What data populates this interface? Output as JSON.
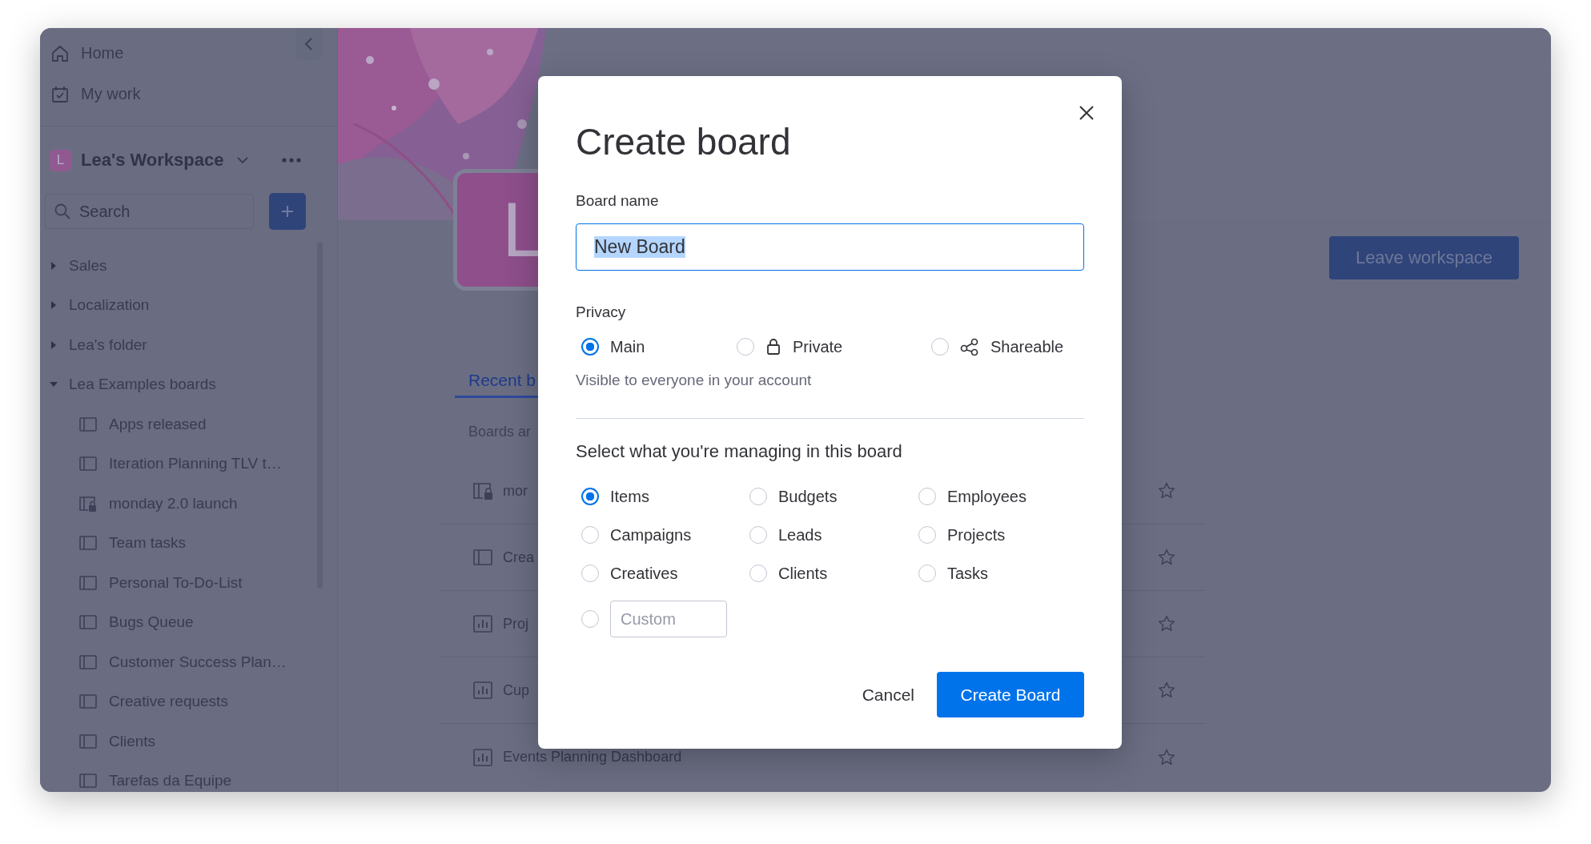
{
  "sidebar": {
    "nav": [
      {
        "label": "Home",
        "kind": "home"
      },
      {
        "label": "My work",
        "kind": "calendar"
      }
    ],
    "workspace": {
      "initial": "L",
      "name": "Lea's Workspace"
    },
    "search": {
      "placeholder": "Search"
    },
    "tree": [
      {
        "label": "Sales",
        "expanded": false
      },
      {
        "label": "Localization",
        "expanded": false
      },
      {
        "label": "Lea's folder",
        "expanded": false
      },
      {
        "label": "Lea Examples boards",
        "expanded": true,
        "children": [
          {
            "label": "Apps released",
            "kind": "board"
          },
          {
            "label": "Iteration Planning TLV t…",
            "kind": "board"
          },
          {
            "label": "monday 2.0 launch",
            "kind": "private-board"
          },
          {
            "label": "Team tasks",
            "kind": "board"
          },
          {
            "label": "Personal To-Do-List",
            "kind": "board"
          },
          {
            "label": "Bugs Queue",
            "kind": "board"
          },
          {
            "label": "Customer Success Plan…",
            "kind": "board"
          },
          {
            "label": "Creative requests",
            "kind": "board"
          },
          {
            "label": "Clients",
            "kind": "board"
          },
          {
            "label": "Tarefas da Equipe",
            "kind": "board"
          }
        ]
      }
    ]
  },
  "workspace_page": {
    "avatar": "L",
    "leave_button": "Leave workspace",
    "tabs": [
      {
        "label": "Recent b",
        "selected": true
      }
    ],
    "subtitle": "Boards ar",
    "boards": [
      {
        "name": "mor",
        "kind": "private-board"
      },
      {
        "name": "Crea",
        "kind": "board"
      },
      {
        "name": "Proj",
        "kind": "dashboard"
      },
      {
        "name": "Cup",
        "kind": "dashboard"
      },
      {
        "name": "Events Planning Dashboard",
        "kind": "dashboard"
      }
    ]
  },
  "dialog": {
    "title": "Create board",
    "board_name": {
      "label": "Board name",
      "value": "New Board"
    },
    "privacy": {
      "label": "Privacy",
      "options": [
        {
          "label": "Main",
          "selected": true
        },
        {
          "label": "Private",
          "kind": "private",
          "selected": false
        },
        {
          "label": "Shareable",
          "kind": "shareable",
          "selected": false
        }
      ],
      "hint": "Visible to everyone in your account"
    },
    "managing": {
      "title": "Select what you're managing in this board",
      "options": [
        {
          "kind": "option",
          "label": "Items",
          "selected": true
        },
        {
          "kind": "option",
          "label": "Budgets",
          "selected": false
        },
        {
          "kind": "option",
          "label": "Employees",
          "selected": false
        },
        {
          "kind": "option",
          "label": "Campaigns",
          "selected": false
        },
        {
          "kind": "option",
          "label": "Leads",
          "selected": false
        },
        {
          "kind": "option",
          "label": "Projects",
          "selected": false
        },
        {
          "kind": "option",
          "label": "Creatives",
          "selected": false
        },
        {
          "kind": "option",
          "label": "Clients",
          "selected": false
        },
        {
          "kind": "option",
          "label": "Tasks",
          "selected": false
        },
        {
          "kind": "custom",
          "placeholder": "Custom",
          "selected": false
        }
      ]
    },
    "buttons": [
      {
        "label": "Cancel",
        "kind": "secondary"
      },
      {
        "label": "Create Board",
        "kind": "primary"
      }
    ]
  }
}
